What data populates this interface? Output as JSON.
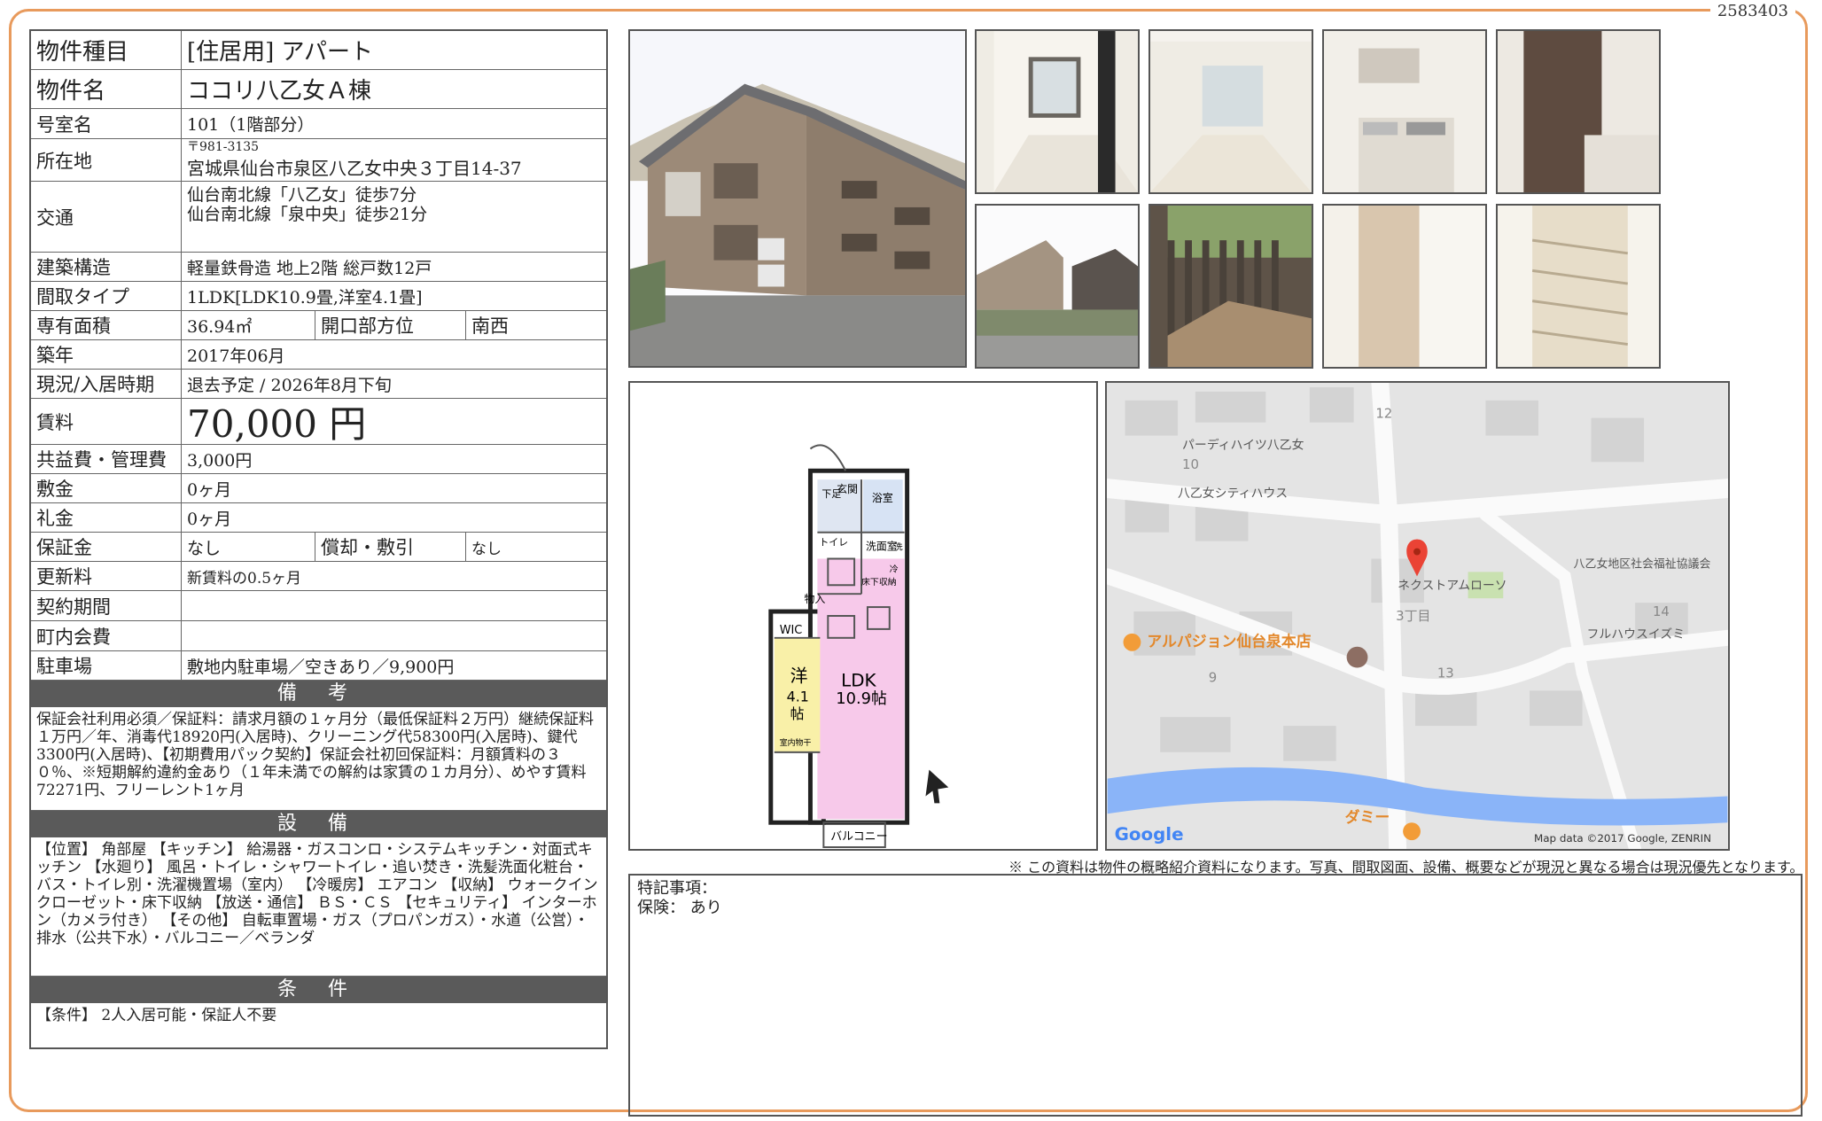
{
  "doc_id": "2583403",
  "property": {
    "type_label": "物件種目",
    "type_value": "[住居用]  アパート",
    "name_label": "物件名",
    "name_value": "ココリ八乙女Ａ棟",
    "room_label": "号室名",
    "room_value": "101（1階部分）",
    "address_label": "所在地",
    "postal": "〒981-3135",
    "address": "宮城県仙台市泉区八乙女中央３丁目14-37",
    "access_label": "交通",
    "access_1": "仙台南北線「八乙女」徒歩7分",
    "access_2": "仙台南北線「泉中央」徒歩21分",
    "structure_label": "建築構造",
    "structure_value": "軽量鉄骨造 地上2階 総戸数12戸",
    "layout_label": "間取タイプ",
    "layout_value": "1LDK[LDK10.9畳,洋室4.1畳]",
    "area_label": "専有面積",
    "area_value": "36.94㎡",
    "direction_label": "開口部方位",
    "direction_value": "南西",
    "built_label": "築年",
    "built_value": "2017年06月",
    "status_label": "現況/入居時期",
    "status_value": "退去予定 /  2026年8月下旬",
    "rent_label": "賃料",
    "rent_value": "70,000 円",
    "fee_label": "共益費・管理費",
    "fee_value": "3,000円",
    "deposit_label": "敷金",
    "deposit_value": "0ヶ月",
    "key_money_label": "礼金",
    "key_money_value": "0ヶ月",
    "guarantee_label": "保証金",
    "guarantee_value": "なし",
    "amortize_label": "償却・敷引",
    "amortize_value": "なし",
    "renewal_label": "更新料",
    "renewal_value": "新賃料の0.5ヶ月",
    "contract_label": "契約期間",
    "contract_value": "",
    "community_label": "町内会費",
    "community_value": "",
    "parking_label": "駐車場",
    "parking_value": "敷地内駐車場／空きあり／9,900円"
  },
  "remarks": {
    "title": "備 考",
    "text": "保証会社利用必須／保証料：請求月額の１ヶ月分（最低保証料２万円）継続保証料１万円／年、消毒代18920円(入居時)、クリーニング代58300円(入居時)、鍵代3300円(入居時)、【初期費用パック契約】保証会社初回保証料：月額賃料の３０％、※短期解約違約金あり（１年未満での解約は家賃の１カ月分）、めやす賃料72271円、フリーレント1ヶ月"
  },
  "equipment": {
    "title": "設 備",
    "text": "【位置】 角部屋 【キッチン】 給湯器・ガスコンロ・システムキッチン・対面式キッチン 【水廻り】 風呂・トイレ・シャワートイレ・追い焚き・洗髪洗面化粧台・バス・トイレ別・洗濯機置場（室内） 【冷暖房】 エアコン 【収納】 ウォークインクローゼット・床下収納 【放送・通信】 ＢＳ・ＣＳ 【セキュリティ】 インターホン（カメラ付き） 【その他】 自転車置場・ガス（プロパンガス）・水道（公営）・排水（公共下水）・バルコニー／ベランダ"
  },
  "conditions": {
    "title": "条 件",
    "text": "【条件】 2人入居可能・保証人不要"
  },
  "floorplan": {
    "entrance": "玄関",
    "bath": "浴室",
    "washroom": "洗面室",
    "toilet": "トイレ",
    "storage": "物入",
    "wic": "WIC",
    "western": "洋",
    "western_size": "4.1",
    "western_unit": "帖",
    "ldk": "LDK",
    "ldk_size": "10.9帖",
    "balcony": "バルコニー",
    "underfloor": "床下収納",
    "fridge": "冷",
    "washer": "洗",
    "closet_label": "室内物干",
    "shoes": "下足"
  },
  "map": {
    "labels": [
      "パーディハイツ八乙女",
      "八乙女シティハウス",
      "ネクストアムローソ",
      "3丁目",
      "八乙女地区社会福祉協議会",
      "フルハウスイズミ",
      "アルパジョン仙台泉本店",
      "ダミー"
    ],
    "numbers": [
      "12",
      "10",
      "14",
      "13",
      "9"
    ],
    "google": "Google",
    "copyright": "Map data ©2017 Google, ZENRIN"
  },
  "note": "※ この資料は物件の概略紹介資料になります。写真、間取図面、設備、概要などが現況と異なる場合は現況優先となります。",
  "memo": {
    "special_label": "特記事項：",
    "insurance_label": "保険：",
    "insurance_value": "あり"
  }
}
